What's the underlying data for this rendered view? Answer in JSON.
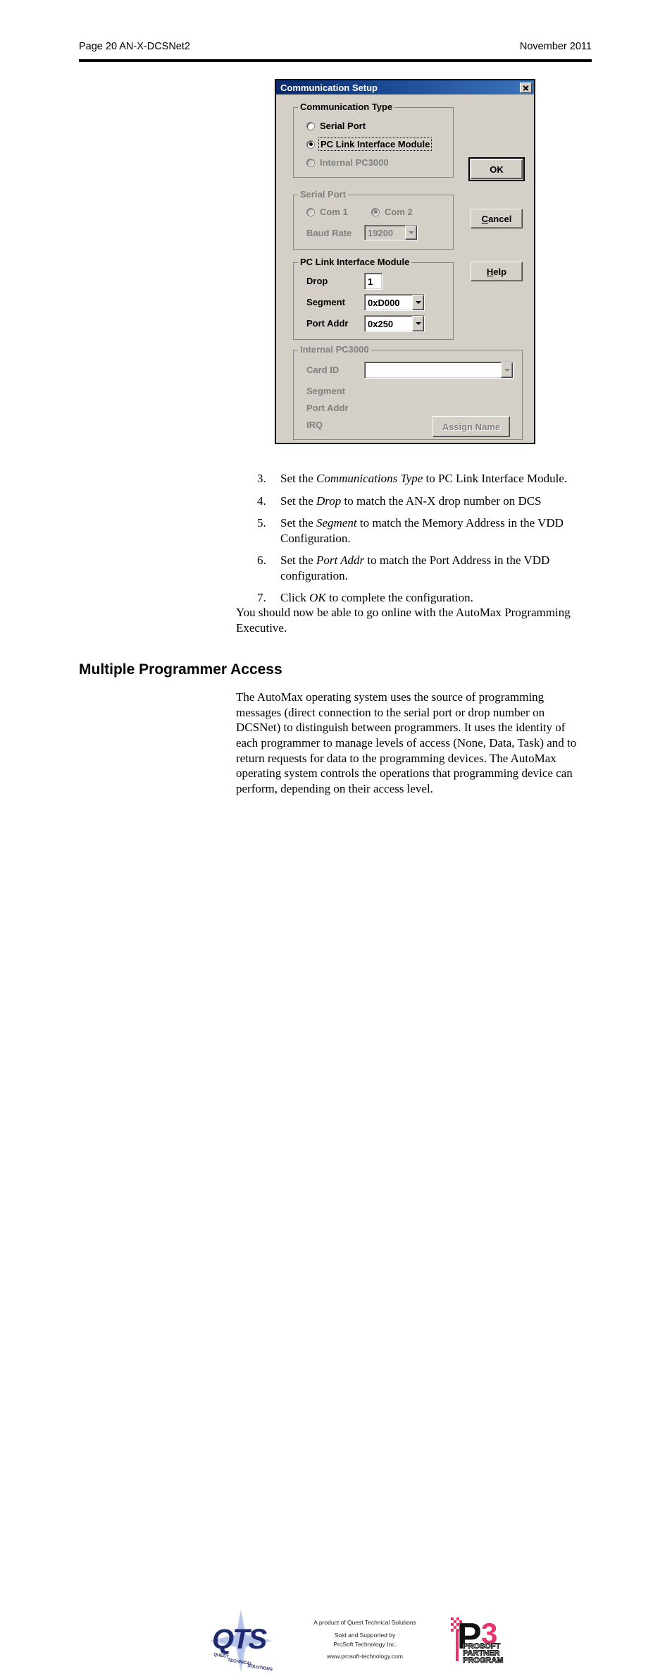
{
  "header": {
    "left": "Page  20  AN-X-DCSNet2",
    "right": "November 2011"
  },
  "dialog": {
    "title": "Communication Setup",
    "close_icon": "close-icon",
    "communication_type": {
      "legend": "Communication Type",
      "options": [
        {
          "label": "Serial Port",
          "selected": false,
          "disabled": false
        },
        {
          "label": "PC Link Interface Module",
          "selected": true,
          "disabled": false
        },
        {
          "label": "Internal PC3000",
          "selected": false,
          "disabled": true
        }
      ]
    },
    "serial_port": {
      "legend": "Serial Port",
      "com1_label": "Com 1",
      "com2_label": "Com 2",
      "baud_rate_label": "Baud Rate",
      "baud_rate_value": "19200"
    },
    "pc_link": {
      "legend": "PC Link Interface Module",
      "drop_label": "Drop",
      "drop_value": "1",
      "segment_label": "Segment",
      "segment_value": "0xD000",
      "port_addr_label": "Port Addr",
      "port_addr_value": "0x250"
    },
    "internal_pc3000": {
      "legend": "Internal PC3000",
      "card_id_label": "Card ID",
      "card_id_value": "",
      "segment_label": "Segment",
      "port_addr_label": "Port Addr",
      "irq_label": "IRQ",
      "assign_name_label": "Assign Name"
    },
    "buttons": {
      "ok": "OK",
      "cancel_prefix": "C",
      "cancel_rest": "ancel",
      "help_prefix": "H",
      "help_rest": "elp"
    }
  },
  "steps": [
    {
      "num": "3.",
      "pre": "Set the ",
      "em": "Communications Type",
      "post": " to PC Link Interface Module."
    },
    {
      "num": "4.",
      "pre": "Set the ",
      "em": "Drop",
      "post": " to match the AN-X drop number on DCS"
    },
    {
      "num": "5.",
      "pre": "Set the ",
      "em": "Segment",
      "post": " to match the Memory Address in the VDD Configuration."
    },
    {
      "num": "6.",
      "pre": "Set the ",
      "em": "Port Addr",
      "post": " to match the Port Address in the VDD configuration."
    },
    {
      "num": "7.",
      "pre": "Click ",
      "em": "OK",
      "post": " to complete the configuration."
    }
  ],
  "paragraph_after_list": "You should now be able to go online with the AutoMax Programming Executive.",
  "section": {
    "heading": "Multiple Programmer Access",
    "body": "The AutoMax  operating system uses the source of programming messages (direct connection to the serial port or drop number on DCSNet) to distinguish between programmers.  It uses the identity of each programmer to manage levels of access (None, Data, Task) and to return requests for data to the programming devices. The AutoMax operating system controls the operations that programming device can perform, depending on their access level."
  },
  "footer": {
    "qts_logo_name": "qts-logo",
    "qts_text": "QTS",
    "qts_tagline1": "QUEST",
    "qts_tagline2": "TECHNICAL",
    "qts_tagline3": "SOLUTIONS",
    "line1": "A product of Quest Technical Solutions",
    "line2": "Sold and Supported by",
    "line3": "ProSoft Technology Inc.",
    "line4": "www.prosoft-technology.com",
    "p3_logo_name": "p3-prosoft-partner-program-logo",
    "p3_letter": "P",
    "p3_number": "3",
    "p3_line1": "PROSOFT",
    "p3_line2": "PARTNER",
    "p3_line3": "PROGRAM"
  },
  "colors": {
    "title_bar_start": "#0a2a6b",
    "title_bar_end": "#3d74bb",
    "dialog_face": "#d4d0c8",
    "disabled_text": "#808080",
    "qts_navy": "#1f2a6e",
    "qts_star": "#b9c6e8",
    "p3_pink": "#e8336d"
  }
}
